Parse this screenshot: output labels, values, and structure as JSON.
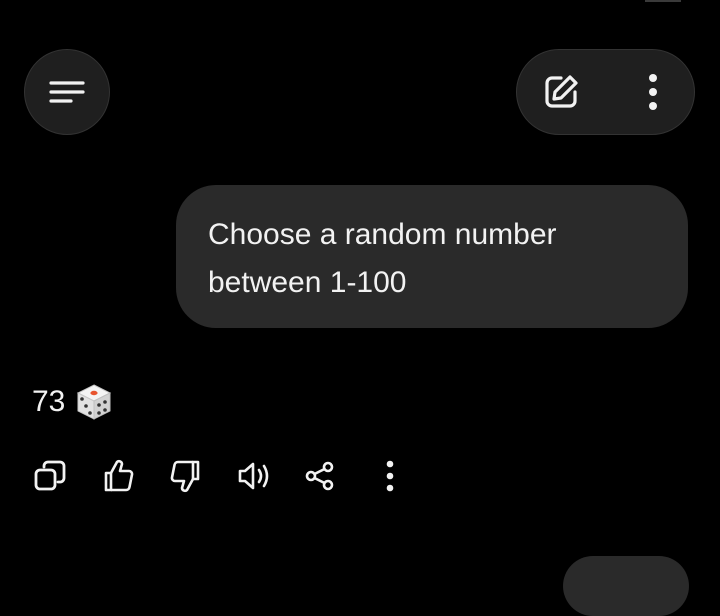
{
  "app": {
    "accent_bg": "#000000",
    "bubble_color": "#2a2a2a",
    "button_color": "#1f1f1f"
  },
  "header": {
    "menu_icon": "menu-lines-icon",
    "new_chat_icon": "edit-pencil-icon",
    "more_icon": "more-vertical-icon"
  },
  "conversation": {
    "user_message": "Choose a random number\nbetween 1-100",
    "assistant_reply": {
      "text": "73",
      "emoji": "🎲"
    }
  },
  "toolbar": {
    "icons": [
      "copy-icon",
      "thumbs-up-icon",
      "thumbs-down-icon",
      "read-aloud-icon",
      "share-icon",
      "more-vertical-icon"
    ]
  }
}
